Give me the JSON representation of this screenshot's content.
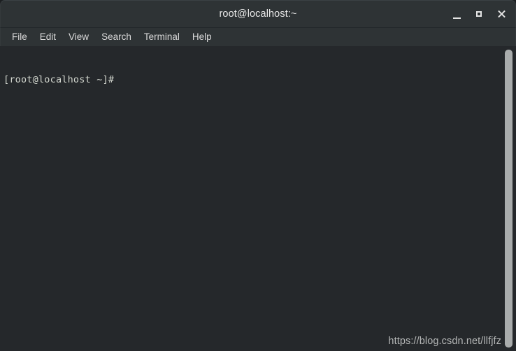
{
  "window": {
    "title": "root@localhost:~",
    "controls": {
      "minimize_label": "Minimize",
      "maximize_label": "Maximize",
      "close_label": "Close"
    }
  },
  "menubar": {
    "items": [
      {
        "label": "File"
      },
      {
        "label": "Edit"
      },
      {
        "label": "View"
      },
      {
        "label": "Search"
      },
      {
        "label": "Terminal"
      },
      {
        "label": "Help"
      }
    ]
  },
  "terminal": {
    "lines": [
      "[root@localhost ~]#"
    ],
    "prompt": "[root@localhost ~]#",
    "background_color": "#25282b",
    "text_color": "#d3d7cf"
  },
  "scrollbar": {
    "thumb_color": "#a9acac"
  },
  "watermark": {
    "text": "https://blog.csdn.net/llfjfz"
  }
}
